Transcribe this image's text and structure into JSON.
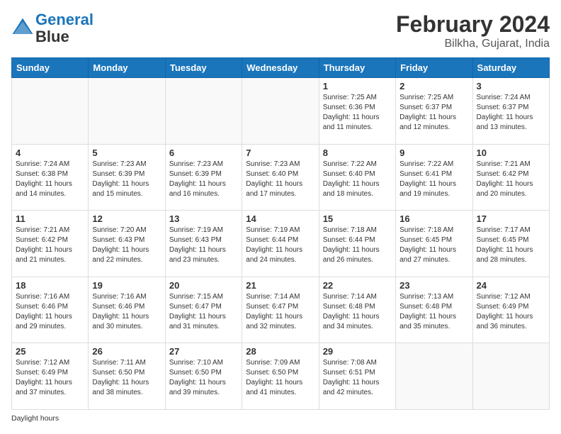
{
  "header": {
    "logo_line1": "General",
    "logo_line2": "Blue",
    "title": "February 2024",
    "subtitle": "Bilkha, Gujarat, India"
  },
  "weekdays": [
    "Sunday",
    "Monday",
    "Tuesday",
    "Wednesday",
    "Thursday",
    "Friday",
    "Saturday"
  ],
  "footer": {
    "daylight_label": "Daylight hours"
  },
  "weeks": [
    [
      {
        "day": "",
        "info": ""
      },
      {
        "day": "",
        "info": ""
      },
      {
        "day": "",
        "info": ""
      },
      {
        "day": "",
        "info": ""
      },
      {
        "day": "1",
        "info": "Sunrise: 7:25 AM\nSunset: 6:36 PM\nDaylight: 11 hours\nand 11 minutes."
      },
      {
        "day": "2",
        "info": "Sunrise: 7:25 AM\nSunset: 6:37 PM\nDaylight: 11 hours\nand 12 minutes."
      },
      {
        "day": "3",
        "info": "Sunrise: 7:24 AM\nSunset: 6:37 PM\nDaylight: 11 hours\nand 13 minutes."
      }
    ],
    [
      {
        "day": "4",
        "info": "Sunrise: 7:24 AM\nSunset: 6:38 PM\nDaylight: 11 hours\nand 14 minutes."
      },
      {
        "day": "5",
        "info": "Sunrise: 7:23 AM\nSunset: 6:39 PM\nDaylight: 11 hours\nand 15 minutes."
      },
      {
        "day": "6",
        "info": "Sunrise: 7:23 AM\nSunset: 6:39 PM\nDaylight: 11 hours\nand 16 minutes."
      },
      {
        "day": "7",
        "info": "Sunrise: 7:23 AM\nSunset: 6:40 PM\nDaylight: 11 hours\nand 17 minutes."
      },
      {
        "day": "8",
        "info": "Sunrise: 7:22 AM\nSunset: 6:40 PM\nDaylight: 11 hours\nand 18 minutes."
      },
      {
        "day": "9",
        "info": "Sunrise: 7:22 AM\nSunset: 6:41 PM\nDaylight: 11 hours\nand 19 minutes."
      },
      {
        "day": "10",
        "info": "Sunrise: 7:21 AM\nSunset: 6:42 PM\nDaylight: 11 hours\nand 20 minutes."
      }
    ],
    [
      {
        "day": "11",
        "info": "Sunrise: 7:21 AM\nSunset: 6:42 PM\nDaylight: 11 hours\nand 21 minutes."
      },
      {
        "day": "12",
        "info": "Sunrise: 7:20 AM\nSunset: 6:43 PM\nDaylight: 11 hours\nand 22 minutes."
      },
      {
        "day": "13",
        "info": "Sunrise: 7:19 AM\nSunset: 6:43 PM\nDaylight: 11 hours\nand 23 minutes."
      },
      {
        "day": "14",
        "info": "Sunrise: 7:19 AM\nSunset: 6:44 PM\nDaylight: 11 hours\nand 24 minutes."
      },
      {
        "day": "15",
        "info": "Sunrise: 7:18 AM\nSunset: 6:44 PM\nDaylight: 11 hours\nand 26 minutes."
      },
      {
        "day": "16",
        "info": "Sunrise: 7:18 AM\nSunset: 6:45 PM\nDaylight: 11 hours\nand 27 minutes."
      },
      {
        "day": "17",
        "info": "Sunrise: 7:17 AM\nSunset: 6:45 PM\nDaylight: 11 hours\nand 28 minutes."
      }
    ],
    [
      {
        "day": "18",
        "info": "Sunrise: 7:16 AM\nSunset: 6:46 PM\nDaylight: 11 hours\nand 29 minutes."
      },
      {
        "day": "19",
        "info": "Sunrise: 7:16 AM\nSunset: 6:46 PM\nDaylight: 11 hours\nand 30 minutes."
      },
      {
        "day": "20",
        "info": "Sunrise: 7:15 AM\nSunset: 6:47 PM\nDaylight: 11 hours\nand 31 minutes."
      },
      {
        "day": "21",
        "info": "Sunrise: 7:14 AM\nSunset: 6:47 PM\nDaylight: 11 hours\nand 32 minutes."
      },
      {
        "day": "22",
        "info": "Sunrise: 7:14 AM\nSunset: 6:48 PM\nDaylight: 11 hours\nand 34 minutes."
      },
      {
        "day": "23",
        "info": "Sunrise: 7:13 AM\nSunset: 6:48 PM\nDaylight: 11 hours\nand 35 minutes."
      },
      {
        "day": "24",
        "info": "Sunrise: 7:12 AM\nSunset: 6:49 PM\nDaylight: 11 hours\nand 36 minutes."
      }
    ],
    [
      {
        "day": "25",
        "info": "Sunrise: 7:12 AM\nSunset: 6:49 PM\nDaylight: 11 hours\nand 37 minutes."
      },
      {
        "day": "26",
        "info": "Sunrise: 7:11 AM\nSunset: 6:50 PM\nDaylight: 11 hours\nand 38 minutes."
      },
      {
        "day": "27",
        "info": "Sunrise: 7:10 AM\nSunset: 6:50 PM\nDaylight: 11 hours\nand 39 minutes."
      },
      {
        "day": "28",
        "info": "Sunrise: 7:09 AM\nSunset: 6:50 PM\nDaylight: 11 hours\nand 41 minutes."
      },
      {
        "day": "29",
        "info": "Sunrise: 7:08 AM\nSunset: 6:51 PM\nDaylight: 11 hours\nand 42 minutes."
      },
      {
        "day": "",
        "info": ""
      },
      {
        "day": "",
        "info": ""
      }
    ]
  ]
}
